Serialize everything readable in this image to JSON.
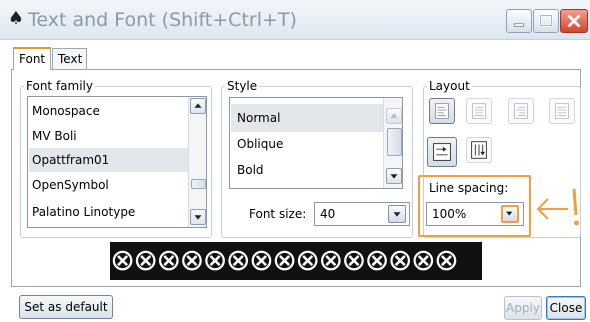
{
  "window": {
    "title": "Text and Font (Shift+Ctrl+T)",
    "title_icon": "spade-icon",
    "controls": [
      "minimize-icon",
      "maximize-icon",
      "close-icon"
    ]
  },
  "tabs": [
    {
      "label": "Font",
      "active": true
    },
    {
      "label": "Text",
      "active": false
    }
  ],
  "font_family": {
    "legend": "Font family",
    "items": [
      "Monospace",
      "MV Boli",
      "Opattfram01",
      "OpenSymbol",
      "Palatino Linotype"
    ],
    "selected": "Opattfram01"
  },
  "style": {
    "legend": "Style",
    "items": [
      "Normal",
      "Oblique",
      "Bold"
    ],
    "selected": "Normal"
  },
  "font_size": {
    "label": "Font size:",
    "value": "40"
  },
  "layout": {
    "legend": "Layout",
    "align_icons": [
      "align-left-icon",
      "align-center-icon",
      "align-right-icon",
      "align-justify-icon"
    ],
    "orientation_icons": [
      "horizontal-text-icon",
      "vertical-text-icon"
    ],
    "line_spacing_label": "Line spacing:",
    "line_spacing_value": "100%"
  },
  "annotation": {
    "color": "#f0a040",
    "arrow_glyph": "←",
    "exclaim": "!"
  },
  "preview": {
    "text": "⊗⊗⊗⊗⊗⊗⊗⊗⊗⊗⊗⊗⊗⊗⊗"
  },
  "buttons": {
    "set_default": "Set as default",
    "apply": "Apply",
    "close": "Close"
  },
  "colors": {
    "highlight": "#f0a040",
    "selected_row": "#e3e6ea",
    "tab_accent": "#e09a30"
  }
}
